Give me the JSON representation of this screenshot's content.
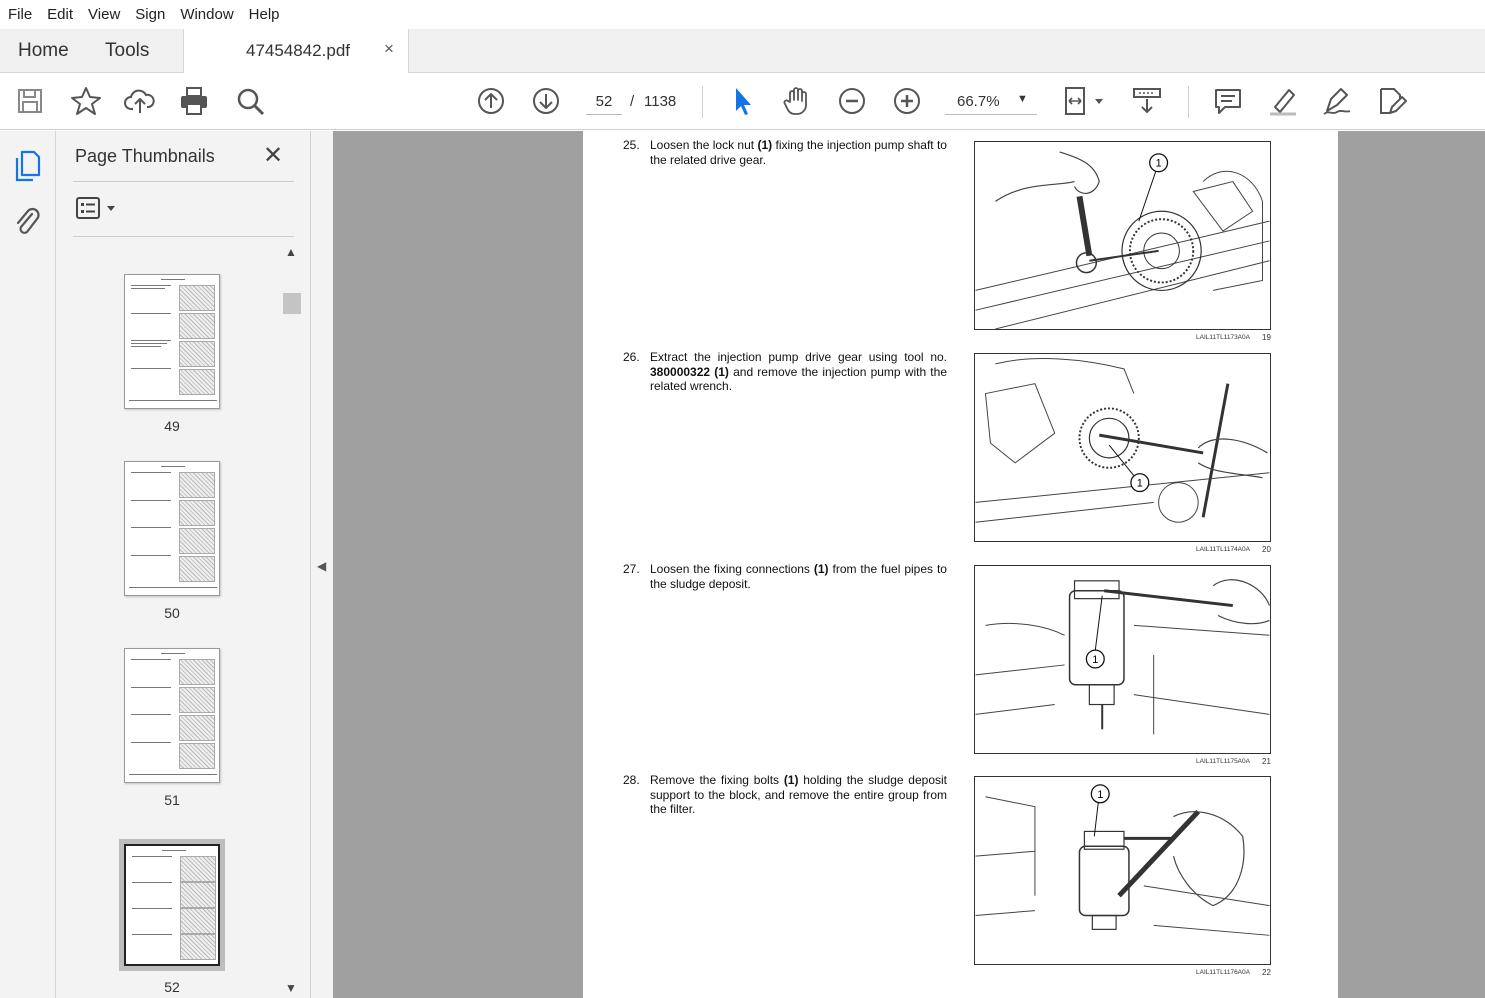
{
  "menu": [
    "File",
    "Edit",
    "View",
    "Sign",
    "Window",
    "Help"
  ],
  "tabs": {
    "home": "Home",
    "tools": "Tools",
    "document": "47454842.pdf",
    "close": "×"
  },
  "toolbar": {
    "current_page": "52",
    "page_separator": "/",
    "total_pages": "1138",
    "zoom": "66.7%",
    "icons": [
      "save-icon",
      "bookmark-star-icon",
      "upload-cloud-icon",
      "print-icon",
      "zoom-search-icon",
      "page-up-icon",
      "page-down-icon",
      "select-arrow-icon",
      "hand-icon",
      "zoom-out-icon",
      "zoom-in-icon",
      "fit-page-icon",
      "scroll-mode-icon",
      "comment-icon",
      "highlight-icon",
      "sign-icon",
      "edit-pdf-icon"
    ]
  },
  "sidebar": {
    "title": "Page Thumbnails",
    "close": "✕",
    "thumbnails": [
      {
        "label": "49"
      },
      {
        "label": "50"
      },
      {
        "label": "51"
      },
      {
        "label": "52",
        "selected": true
      }
    ]
  },
  "document": {
    "steps": [
      {
        "num": "25.",
        "text_parts": [
          "Loosen the lock nut ",
          "(1)",
          " fixing the injection pump shaft to the related drive gear."
        ],
        "fig_code": "LAIL11TL1173A0A",
        "fig_num": "19"
      },
      {
        "num": "26.",
        "text_parts": [
          "Extract the injection pump drive gear using tool no. ",
          "380000322 (1)",
          " and remove the injection pump with the related wrench."
        ],
        "fig_code": "LAIL11TL1174A0A",
        "fig_num": "20"
      },
      {
        "num": "27.",
        "text_parts": [
          "Loosen the fixing connections ",
          "(1)",
          " from the fuel pipes to the sludge deposit."
        ],
        "fig_code": "LAIL11TL1175A0A",
        "fig_num": "21"
      },
      {
        "num": "28.",
        "text_parts": [
          "Remove the fixing bolts ",
          "(1)",
          " holding the sludge deposit support to the block, and remove the entire group from the filter."
        ],
        "fig_code": "LAIL11TL1176A0A",
        "fig_num": "22"
      }
    ],
    "callout": "1"
  }
}
